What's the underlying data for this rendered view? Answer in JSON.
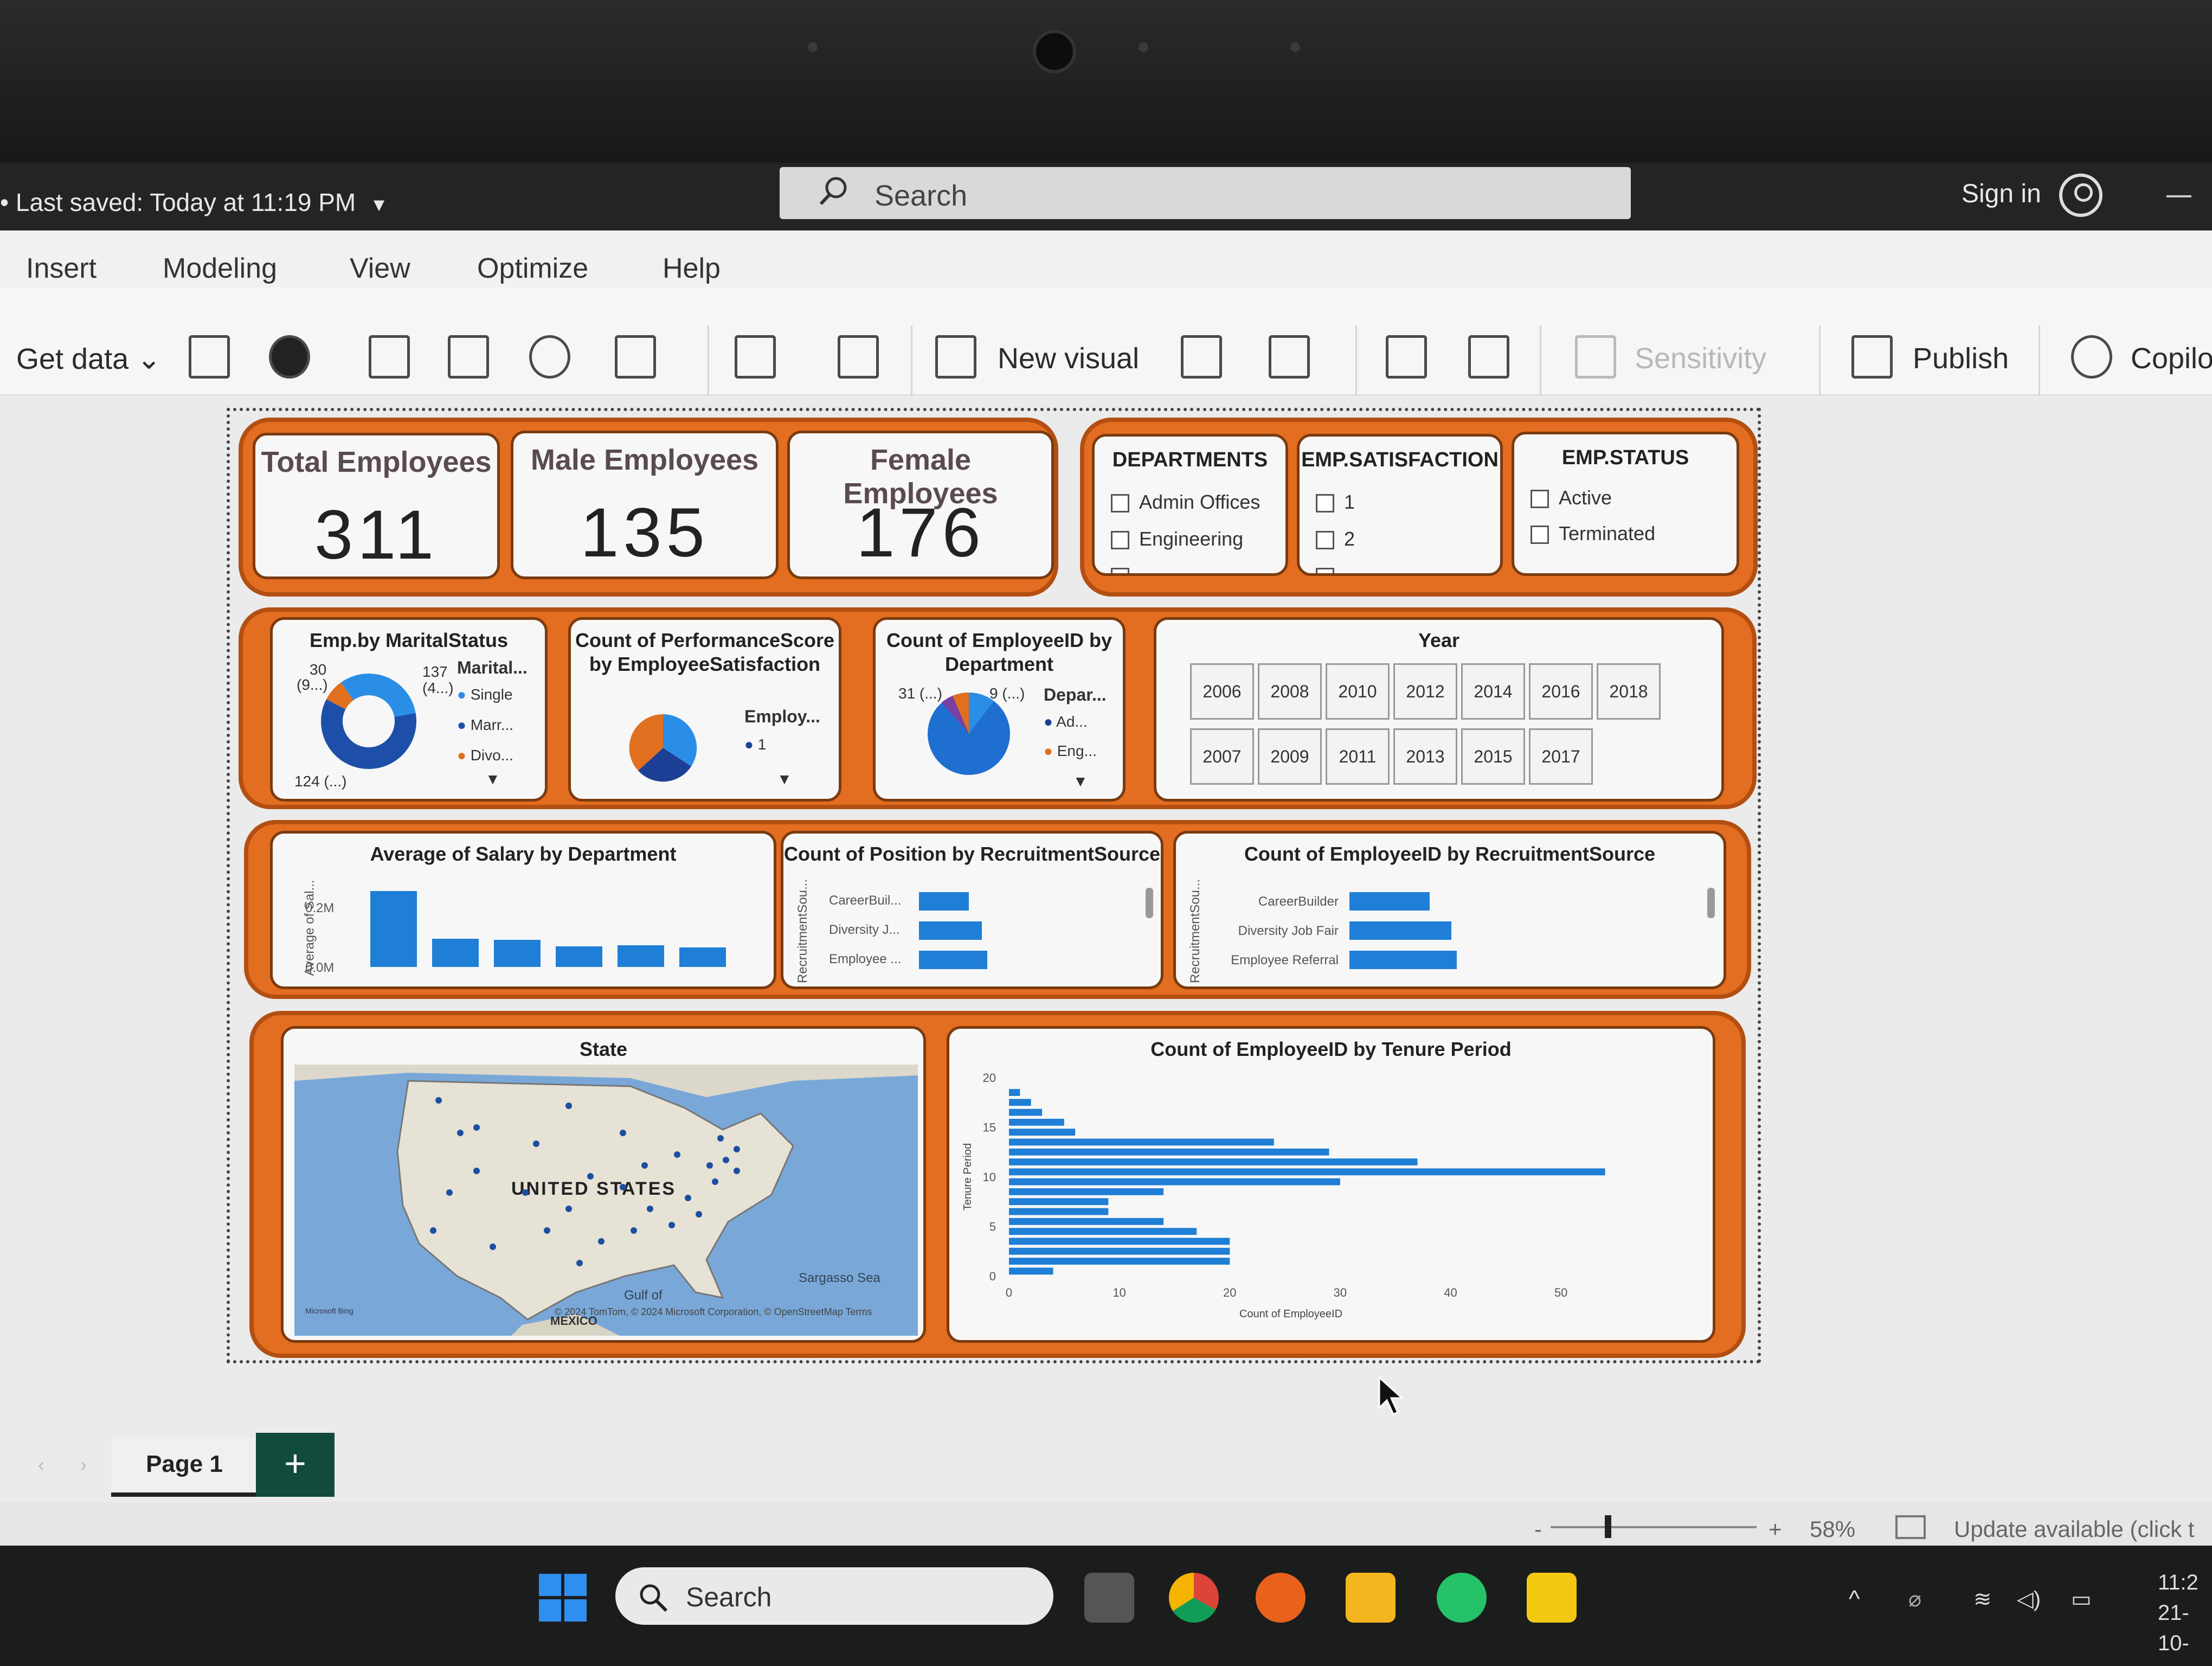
{
  "titlebar": {
    "last_saved": "• Last saved: Today at 11:19 PM",
    "search_placeholder": "Search",
    "sign_in": "Sign in"
  },
  "menu": [
    "Insert",
    "Modeling",
    "View",
    "Optimize",
    "Help"
  ],
  "ribbon": {
    "get_data": "Get data",
    "new_visual": "New visual",
    "sensitivity": "Sensitivity",
    "publish": "Publish",
    "copilot": "Copilo"
  },
  "kpis": [
    {
      "title": "Total Employees",
      "value": "311"
    },
    {
      "title": "Male Employees",
      "value": "135"
    },
    {
      "title": "Female Employees",
      "value": "176"
    }
  ],
  "slicers": {
    "departments": {
      "title": "DEPARTMENTS",
      "items": [
        "Admin Offices",
        "Engineering"
      ]
    },
    "satisfaction": {
      "title": "EMP.SATISFACTION",
      "items": [
        "1",
        "2"
      ]
    },
    "status": {
      "title": "EMP.STATUS",
      "items": [
        "Active",
        "Terminated"
      ]
    }
  },
  "marital": {
    "title": "Emp.by MaritalStatus",
    "legend_title": "Marital...",
    "legend": [
      "Single",
      "Marr...",
      "Divo..."
    ],
    "labels": [
      "30",
      "(9...)",
      "137",
      "(4...)",
      "124 (...)"
    ]
  },
  "performance": {
    "title": "Count of PerformanceScore by EmployeeSatisfaction",
    "legend_title": "Employ...",
    "legend": [
      "1"
    ]
  },
  "dept_pie": {
    "title": "Count of EmployeeID by Department",
    "legend_title": "Depar...",
    "legend": [
      "Ad...",
      "Eng..."
    ],
    "labels": [
      "31 (...)",
      "9 (...)"
    ]
  },
  "year_slicer": {
    "title": "Year",
    "row1": [
      "2006",
      "2008",
      "2010",
      "2012",
      "2014",
      "2016",
      "2018"
    ],
    "row2": [
      "2007",
      "2009",
      "2011",
      "2013",
      "2015",
      "2017"
    ]
  },
  "salary": {
    "title": "Average of Salary by Department",
    "ylabel": "Average of Sal...",
    "ticks": [
      "0.2M",
      "0.0M"
    ]
  },
  "position": {
    "title": "Count of Position by RecruitmentSource",
    "ylabel": "RecruitmentSou...",
    "categories": [
      "CareerBuil...",
      "Diversity J...",
      "Employee ..."
    ]
  },
  "empid_source": {
    "title": "Count of EmployeeID by RecruitmentSource",
    "ylabel": "RecruitmentSou...",
    "categories": [
      "CareerBuilder",
      "Diversity Job Fair",
      "Employee Referral"
    ]
  },
  "map": {
    "title": "State",
    "country": "UNITED STATES",
    "sea": "Sargasso Sea",
    "gulf": "Gulf of",
    "mexico": "MEXICO",
    "bing": "Microsoft Bing",
    "credit": "© 2024 TomTom, © 2024 Microsoft Corporation, © OpenStreetMap  Terms"
  },
  "chart_data": {
    "type": "bar",
    "orientation": "horizontal",
    "title": "Count of EmployeeID by Tenure Period",
    "xlabel": "Count of EmployeeID",
    "ylabel": "Tenure Period",
    "xlim": [
      0,
      55
    ],
    "ylim": [
      0,
      20
    ],
    "x_ticks": [
      0,
      10,
      20,
      30,
      40,
      50
    ],
    "y_ticks": [
      0,
      5,
      10,
      15,
      20
    ],
    "categories": [
      0,
      1,
      2,
      3,
      4,
      5,
      6,
      7,
      8,
      9,
      10,
      11,
      12,
      13,
      14,
      15,
      16,
      17,
      18
    ],
    "values": [
      4,
      20,
      20,
      20,
      17,
      14,
      9,
      9,
      14,
      30,
      54,
      37,
      29,
      24,
      6,
      5,
      3,
      2,
      1
    ]
  },
  "pagebar": {
    "page1": "Page 1",
    "add": "+"
  },
  "statusbar": {
    "zoom": "58%",
    "update": "Update available (click t"
  },
  "taskbar": {
    "search": "Search",
    "time": "11:2",
    "date": "21-10-"
  }
}
